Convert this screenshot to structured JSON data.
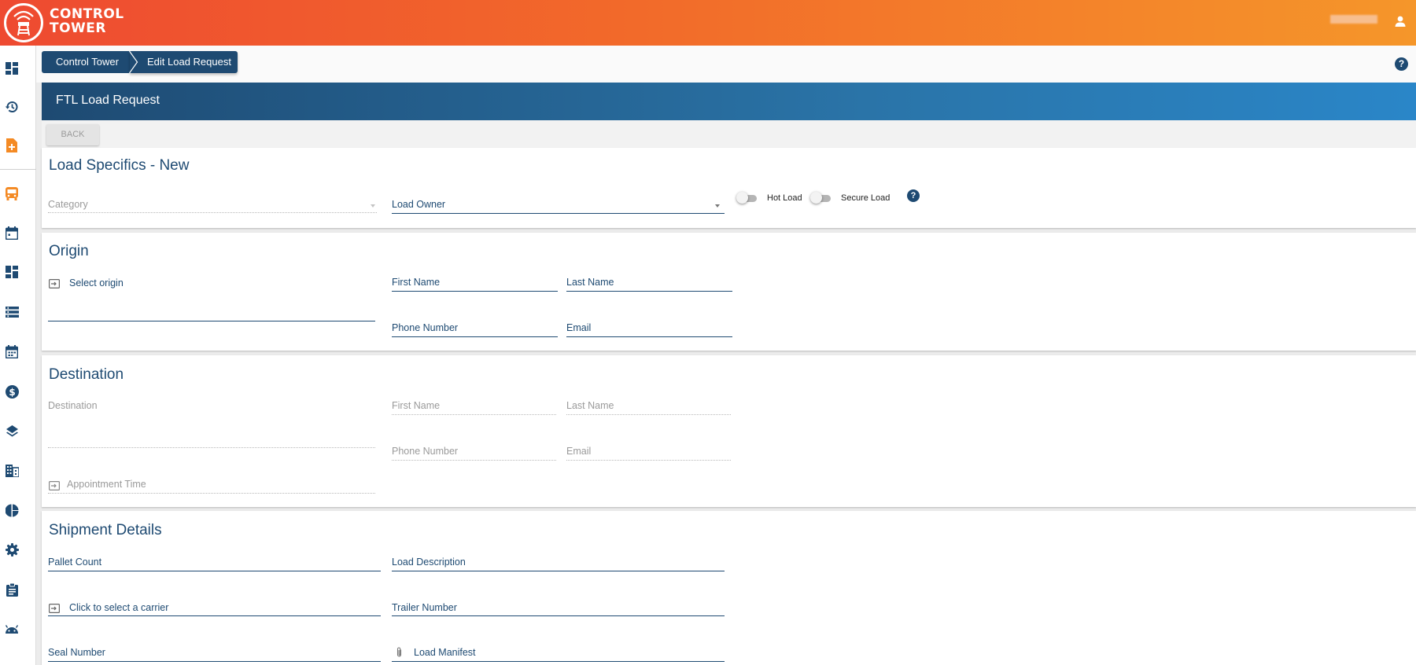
{
  "app": {
    "logo_line1": "CONTROL",
    "logo_line2": "TOWER",
    "brand_colors": {
      "gradient_start": "#ee4a31",
      "gradient_end": "#f5962a",
      "primary": "#1e4a72"
    }
  },
  "sidebar": {
    "items": [
      {
        "icon": "dashboard-icon"
      },
      {
        "icon": "history-icon"
      },
      {
        "icon": "add-document-icon",
        "active": true
      },
      {
        "icon": "bus-icon",
        "active": true
      },
      {
        "icon": "calendar-icon"
      },
      {
        "icon": "dashboard-grid-icon"
      },
      {
        "icon": "list-icon"
      },
      {
        "icon": "calendar-schedule-icon"
      },
      {
        "icon": "dollar-icon"
      },
      {
        "icon": "layers-icon"
      },
      {
        "icon": "building-icon"
      },
      {
        "icon": "pie-chart-icon"
      },
      {
        "icon": "settings-icon"
      },
      {
        "icon": "clipboard-icon"
      },
      {
        "icon": "android-icon"
      }
    ]
  },
  "breadcrumb": {
    "items": [
      "Control Tower",
      "Edit Load Request"
    ]
  },
  "header": {
    "title": "FTL Load Request",
    "back_label": "BACK"
  },
  "load_specifics": {
    "title": "Load Specifics - New",
    "category_label": "Category",
    "load_owner_label": "Load Owner",
    "hot_load_label": "Hot Load",
    "secure_load_label": "Secure Load",
    "help": "?"
  },
  "origin": {
    "title": "Origin",
    "select_origin": "Select origin",
    "first_name": "First Name",
    "last_name": "Last Name",
    "phone": "Phone Number",
    "email": "Email"
  },
  "destination": {
    "title": "Destination",
    "destination": "Destination",
    "first_name": "First Name",
    "last_name": "Last Name",
    "phone": "Phone Number",
    "email": "Email",
    "appointment": "Appointment Time"
  },
  "shipment": {
    "title": "Shipment Details",
    "pallet_count": "Pallet Count",
    "load_description": "Load Description",
    "carrier": "Click to select a carrier",
    "trailer_number": "Trailer Number",
    "seal_number": "Seal Number",
    "load_manifest": "Load Manifest"
  },
  "top_help": "?"
}
